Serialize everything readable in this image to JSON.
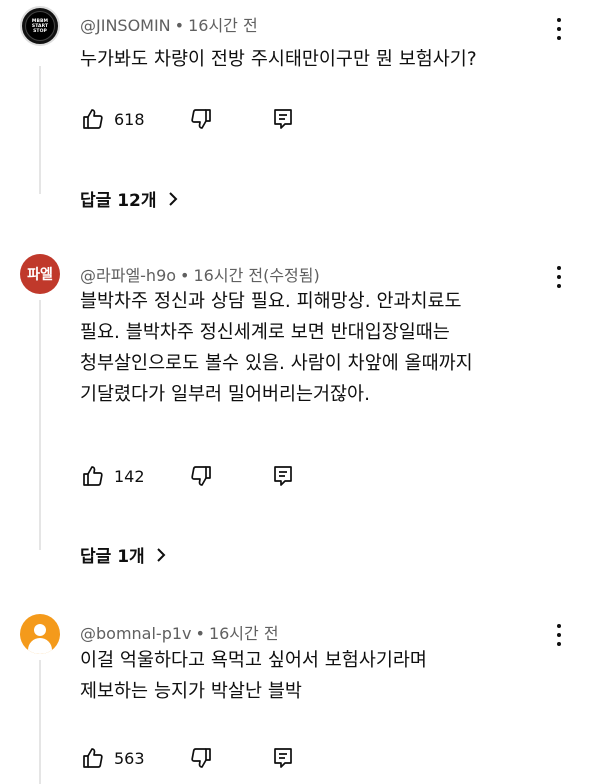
{
  "comments": [
    {
      "author": "@JINSOMIN",
      "time": "16시간 전",
      "lines": [
        "누가봐도 차량이 전방 주시태만이구만 뭔 보험사기?"
      ],
      "likes": "618",
      "replies_label": "답글 12개",
      "avatar_icon": "channel-logo"
    },
    {
      "author": "@라파엘-h9o",
      "time": "16시간 전(수정됨)",
      "lines": [
        "블박차주 정신과 상담 필요. 피해망상. 안과치료도",
        "필요. 블박차주 정신세계로 보면 반대입장일때는",
        "청부살인으로도 볼수 있음. 사람이 차앞에 올때까지",
        "기달렸다가 일부러 밀어버리는거잖아."
      ],
      "likes": "142",
      "replies_label": "답글 1개",
      "avatar_text": "파엘"
    },
    {
      "author": "@bomnal-p1v",
      "time": "16시간 전",
      "lines": [
        "이걸 억울하다고 욕먹고 싶어서 보험사기라며",
        "제보하는 능지가 박살난 블박"
      ],
      "likes": "563",
      "avatar_icon": "default-person"
    }
  ],
  "separator": "•",
  "colors": {
    "meta": "#606060",
    "text": "#0f0f0f",
    "thread_line": "#e5e5e5",
    "avatar2": "#c0392b",
    "avatar3": "#f49a1b"
  }
}
